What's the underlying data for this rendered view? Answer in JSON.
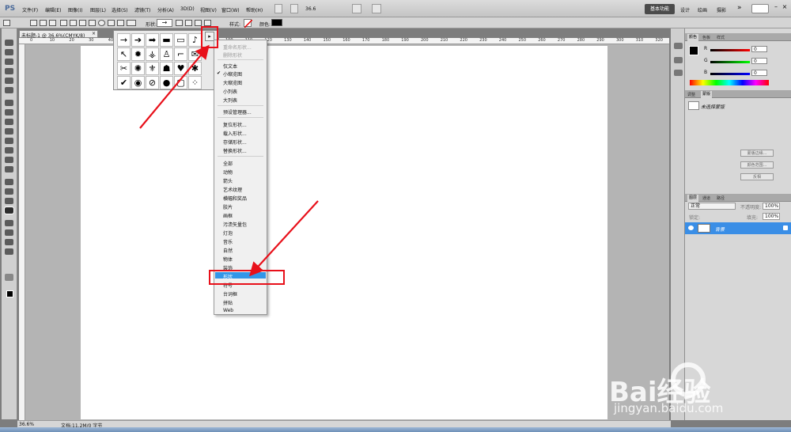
{
  "app": {
    "logo": "PS"
  },
  "menubar": {
    "items": [
      "文件(F)",
      "编辑(E)",
      "图像(I)",
      "图层(L)",
      "选择(S)",
      "滤镜(T)",
      "分析(A)",
      "3D(D)",
      "视图(V)",
      "窗口(W)",
      "帮助(H)"
    ],
    "zoom": "36.6",
    "workspaces": [
      "基本功能",
      "设计",
      "绘画",
      "摄影"
    ],
    "more": "»"
  },
  "options": {
    "shape_label": "形状:",
    "shape_value": "→",
    "style_label": "样式:",
    "color_label": "颜色:",
    "color_hex": "#000000"
  },
  "document": {
    "tab_title": "未标题-1 @ 36.6%(CMYK/8)",
    "close": "×"
  },
  "ruler": {
    "labels": [
      "0",
      "10",
      "20",
      "30",
      "40",
      "50",
      "60",
      "70",
      "80",
      "90",
      "100",
      "110",
      "120",
      "130",
      "140",
      "150",
      "160",
      "170",
      "180",
      "190",
      "200",
      "210",
      "220",
      "230",
      "240",
      "250",
      "260",
      "270",
      "280",
      "290",
      "300",
      "310",
      "320"
    ]
  },
  "shape_picker": {
    "shapes": [
      "→",
      "➔",
      "➡",
      "▬",
      "▭",
      "♪",
      "↖",
      "✹",
      "⚶",
      "♙",
      "⌐",
      "✉",
      "✂",
      "✺",
      "⚜",
      "☗",
      "♥",
      "✱",
      "✔",
      "◉",
      "⊘",
      "●",
      "▢",
      "⁘"
    ],
    "menu_btn": "▸"
  },
  "dropdown": {
    "items_top": [
      "重命名形状...",
      "删除形状"
    ],
    "view_items": [
      "仅文本",
      "小缩览图",
      "大缩览图",
      "小列表",
      "大列表"
    ],
    "manager": "预设管理器...",
    "io_items": [
      "复位形状...",
      "载入形状...",
      "存储形状...",
      "替换形状..."
    ],
    "libraries": [
      "全部",
      "动物",
      "箭头",
      "艺术纹理",
      "横幅和奖品",
      "胶片",
      "画框",
      "污渍矢量包",
      "灯泡",
      "音乐",
      "自然",
      "物体",
      "装饰",
      "形状",
      "符号",
      "台词框",
      "拼贴",
      "Web"
    ],
    "checked": "小缩览图",
    "selected": "形状",
    "check_mark": "✔"
  },
  "panels": {
    "color": {
      "tabs": [
        "颜色",
        "色板",
        "样式"
      ],
      "r_label": "R",
      "g_label": "G",
      "b_label": "B",
      "r": "0",
      "g": "0",
      "b": "0"
    },
    "adjust": {
      "tabs": [
        "调整",
        "蒙版"
      ],
      "title": "未选择蒙版",
      "buttons": [
        "蒙版边缘...",
        "颜色范围...",
        "反相"
      ]
    },
    "layers": {
      "tabs": [
        "图层",
        "通道",
        "路径"
      ],
      "blend": "正常",
      "opacity_label": "不透明度:",
      "opacity": "100%",
      "lock_label": "锁定:",
      "fill_label": "填充:",
      "fill": "100%",
      "layer_name": "背景"
    }
  },
  "status": {
    "zoom": "36.6%",
    "doc_info": "文档:11.2M/0 字节"
  },
  "watermark": {
    "main": "Bai经验",
    "sub": "jingyan.baidu.com"
  }
}
